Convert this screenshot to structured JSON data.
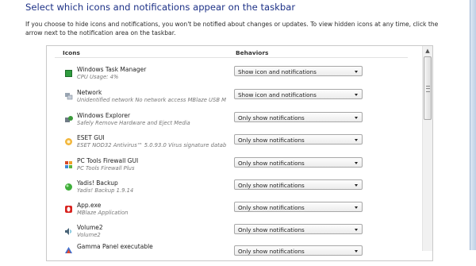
{
  "header": {
    "title": "Select which icons and notifications appear on the taskbar",
    "description": "If you choose to hide icons and notifications, you won't be notified about changes or updates. To view hidden icons at any time, click the arrow next to the notification area on the taskbar."
  },
  "table": {
    "col_icons": "Icons",
    "col_behaviors": "Behaviors",
    "rows": [
      {
        "name": "Windows Task Manager",
        "sub": "CPU Usage: 4%",
        "behavior": "Show icon and notifications",
        "icon": "task-manager-icon"
      },
      {
        "name": "Network",
        "sub": "Unidentified network No network access MBlaze USB Mode...",
        "behavior": "Show icon and notifications",
        "icon": "network-icon"
      },
      {
        "name": "Windows Explorer",
        "sub": "Safely Remove Hardware and Eject Media",
        "behavior": "Only show notifications",
        "icon": "safely-remove-icon"
      },
      {
        "name": "ESET GUI",
        "sub": "ESET NOD32 Antivirus™ 5.0.93.0 Virus signature database: 7...",
        "behavior": "Only show notifications",
        "icon": "eset-icon"
      },
      {
        "name": "PC Tools Firewall GUI",
        "sub": "PC Tools Firewall Plus",
        "behavior": "Only show notifications",
        "icon": "firewall-icon"
      },
      {
        "name": "Yadis! Backup",
        "sub": "Yadis! Backup 1.9.14",
        "behavior": "Only show notifications",
        "icon": "yadis-backup-icon"
      },
      {
        "name": "App.exe",
        "sub": "MBlaze Application",
        "behavior": "Only show notifications",
        "icon": "mblaze-app-icon"
      },
      {
        "name": "Volume2",
        "sub": "Volume2",
        "behavior": "Only show notifications",
        "icon": "volume-icon"
      },
      {
        "name": "Gamma Panel executable",
        "sub": "",
        "behavior": "Only show notifications",
        "icon": "gamma-panel-icon"
      }
    ]
  },
  "colors": {
    "heading": "#1e3287",
    "frame": "#b9cde4"
  }
}
